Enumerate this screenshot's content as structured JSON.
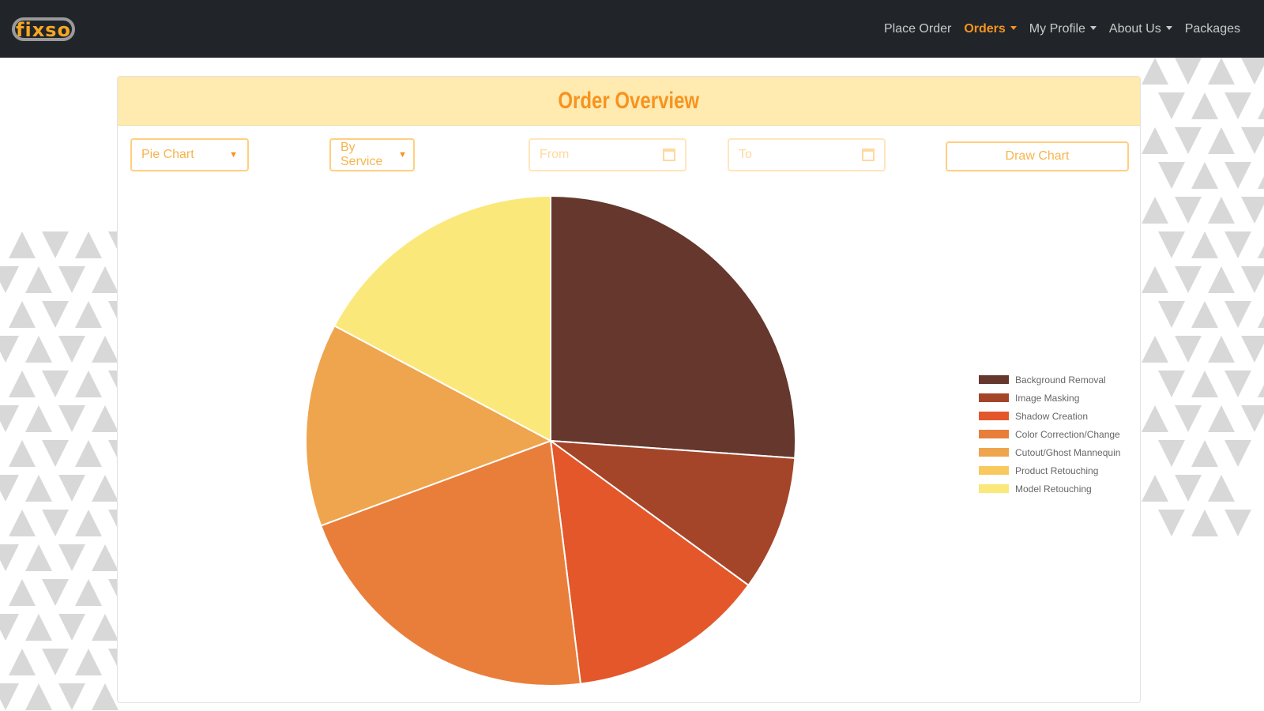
{
  "nav": {
    "logo": "fixso",
    "items": [
      {
        "label": "Place Order",
        "active": false,
        "dropdown": false
      },
      {
        "label": "Orders",
        "active": true,
        "dropdown": true
      },
      {
        "label": "My Profile",
        "active": false,
        "dropdown": true
      },
      {
        "label": "About Us",
        "active": false,
        "dropdown": true
      },
      {
        "label": "Packages",
        "active": false,
        "dropdown": false
      }
    ]
  },
  "card": {
    "title": "Order Overview"
  },
  "controls": {
    "chart_type": "Pie Chart",
    "group_by": "By Service",
    "from_placeholder": "From",
    "to_placeholder": "To",
    "draw_label": "Draw Chart"
  },
  "chart_data": {
    "type": "pie",
    "title": "",
    "legend_position": "right",
    "categories": [
      "Background Removal",
      "Image Masking",
      "Shadow Creation",
      "Color Correction/Change",
      "Cutout/Ghost Mannequin",
      "Product Retouching",
      "Model Retouching"
    ],
    "values": [
      26.1,
      8.9,
      13.0,
      21.3,
      13.4,
      0,
      17.2
    ],
    "colors": [
      "#65372d",
      "#a4452a",
      "#e3572b",
      "#e97e3b",
      "#efa54e",
      "#f9c95e",
      "#fbe87a"
    ]
  }
}
